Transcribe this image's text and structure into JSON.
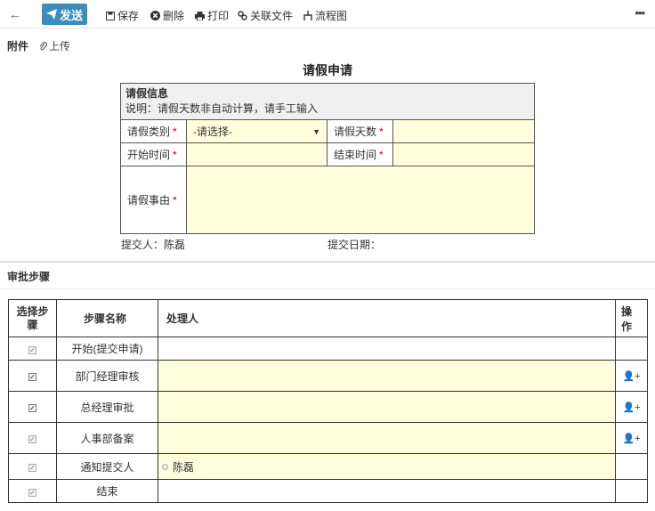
{
  "toolbar": {
    "send_label": "发送",
    "save_label": "保存",
    "delete_label": "删除",
    "print_label": "打印",
    "related_label": "关联文件",
    "flow_label": "流程图",
    "more_label": "•••"
  },
  "attachments": {
    "label": "附件",
    "upload_label": "上传"
  },
  "form": {
    "title": "请假申请",
    "section_title": "请假信息",
    "section_note": "说明：请假天数非自动计算，请手工输入",
    "type_label": "请假类别",
    "type_value": "-请选择-",
    "days_label": "请假天数",
    "start_label": "开始时间",
    "end_label": "结束时间",
    "reason_label": "请假事由",
    "required_mark": "*",
    "submitter_label": "提交人：",
    "submitter_value": "陈磊",
    "submit_date_label": "提交日期："
  },
  "approval": {
    "title": "审批步骤",
    "headers": {
      "select": "选择步骤",
      "name": "步骤名称",
      "handler": "处理人",
      "action": "操作"
    },
    "steps": [
      {
        "name": "开始(提交申请)",
        "handler": ""
      },
      {
        "name": "部门经理审核",
        "handler": ""
      },
      {
        "name": "总经理审批",
        "handler": ""
      },
      {
        "name": "人事部备案",
        "handler": ""
      },
      {
        "name": "通知提交人",
        "handler": "陈磊"
      },
      {
        "name": "结束",
        "handler": ""
      }
    ]
  }
}
